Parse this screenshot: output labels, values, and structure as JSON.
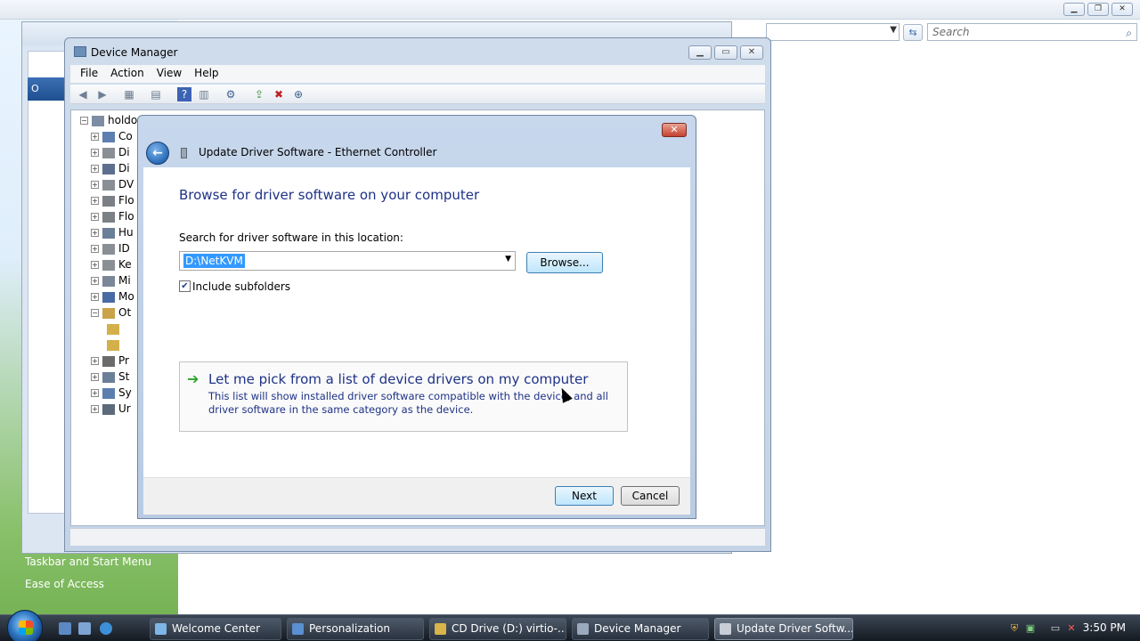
{
  "background": {
    "search_placeholder": "Search",
    "control_panel_links": [
      "Taskbar and Start Menu",
      "Ease of Access"
    ]
  },
  "device_manager": {
    "title": "Device Manager",
    "menu": [
      "File",
      "Action",
      "View",
      "Help"
    ],
    "tree_root": "holdo",
    "tree_rows": [
      "Co",
      "Di",
      "Di",
      "DV",
      "Flo",
      "Flo",
      "Hu",
      "ID",
      "Ke",
      "Mi",
      "Mo",
      "Ot",
      "",
      "",
      "Pr",
      "St",
      "Sy",
      "Ur"
    ]
  },
  "dialog": {
    "title": "Update Driver Software - Ethernet Controller",
    "heading": "Browse for driver software on your computer",
    "search_label": "Search for driver software in this location:",
    "path_value": "D:\\NetKVM",
    "browse_label": "Browse...",
    "include_subfolders_label": "Include subfolders",
    "include_subfolders_checked": true,
    "pick_title": "Let me pick from a list of device drivers on my computer",
    "pick_description": "This list will show installed driver software compatible with the device, and all driver software in the same category as the device.",
    "next_label": "Next",
    "cancel_label": "Cancel"
  },
  "taskbar": {
    "buttons": [
      {
        "label": "Welcome Center",
        "icon": "welcome-icon",
        "color": "#7fb6e8"
      },
      {
        "label": "Personalization",
        "icon": "personalization-icon",
        "color": "#5a8fd1"
      },
      {
        "label": "CD Drive (D:) virtio-...",
        "icon": "folder-icon",
        "color": "#d8b44a"
      },
      {
        "label": "Device Manager",
        "icon": "device-manager-icon",
        "color": "#9aa9bc"
      },
      {
        "label": "Update Driver Softw...",
        "icon": "driver-icon",
        "color": "#c8ced6",
        "active": true
      }
    ],
    "clock": "3:50 PM"
  }
}
